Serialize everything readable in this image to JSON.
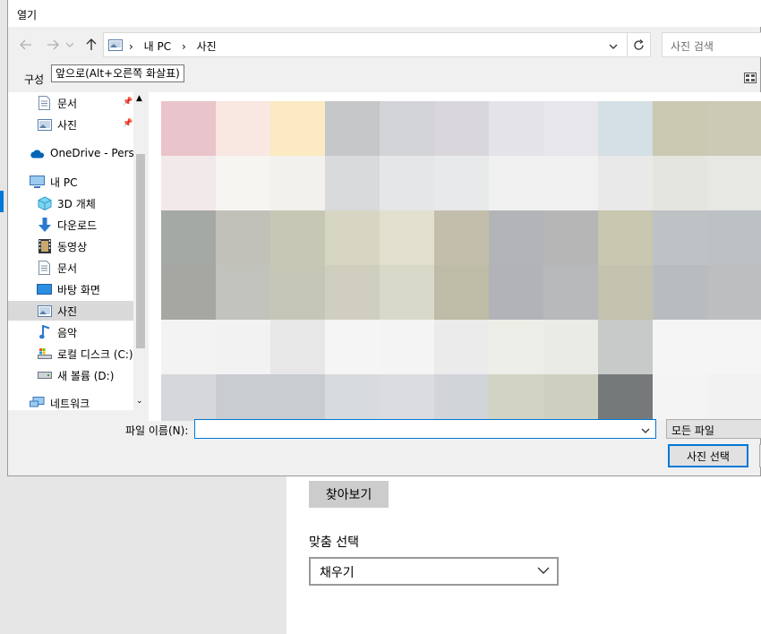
{
  "dialog": {
    "title": "열기",
    "nav": {
      "back_icon": "back-arrow-icon",
      "forward_icon": "forward-arrow-icon",
      "recent_icon": "chevron-down-icon",
      "up_icon": "up-arrow-icon"
    },
    "breadcrumb": [
      "내 PC",
      "사진"
    ],
    "search_placeholder": "사진 검색",
    "toolbar": {
      "organize_label": "구성",
      "tooltip": "앞으로(Alt+오른쪽 화살표)"
    },
    "sidebar": {
      "items": [
        {
          "label": "문서",
          "icon": "document-icon",
          "pinned": true
        },
        {
          "label": "사진",
          "icon": "pictures-icon",
          "pinned": true
        },
        {
          "label": "OneDrive - Person",
          "icon": "onedrive-cloud-icon"
        },
        {
          "label": "내 PC",
          "icon": "computer-icon"
        },
        {
          "label": "3D 개체",
          "icon": "3d-objects-icon"
        },
        {
          "label": "다운로드",
          "icon": "download-arrow-icon"
        },
        {
          "label": "동영상",
          "icon": "video-icon"
        },
        {
          "label": "문서",
          "icon": "document-icon"
        },
        {
          "label": "바탕 화면",
          "icon": "desktop-icon"
        },
        {
          "label": "사진",
          "icon": "pictures-icon",
          "selected": true
        },
        {
          "label": "음악",
          "icon": "music-note-icon"
        },
        {
          "label": "로컬 디스크 (C:)",
          "icon": "local-disk-icon"
        },
        {
          "label": "새 볼륨 (D:)",
          "icon": "drive-icon"
        },
        {
          "label": "네트워크",
          "icon": "network-icon"
        }
      ]
    },
    "filename_label": "파일 이름(N):",
    "filename_value": "",
    "filetype": "모든 파일",
    "open_button": "사진 선택",
    "thumbnail_colors": [
      [
        "#e9c4ca",
        "#f9e7e1",
        "#fbeac2",
        "#c6c7c9",
        "#d2d4d8",
        "#dad7dc",
        "#e4e4e8",
        "#e7e6ea",
        "#d4e0e5",
        "#cac9b2",
        "#cbcbb5"
      ],
      [
        "#f2e9ea",
        "#f7f5f2",
        "#f2f1ed",
        "#d9dadb",
        "#e5e6e8",
        "#e8e9ea",
        "#f0f0f0",
        "#f0f0f0",
        "#e9e9ea",
        "#e5e5df",
        "#e7e7e4"
      ],
      [
        "#a5a9a6",
        "#c1c1ba",
        "#c7c7b5",
        "#d6d6c2",
        "#e1e0cf",
        "#c2beab",
        "#b2b4b7",
        "#b5b6b5",
        "#c8c7af",
        "#bec2c4",
        "#bcc1c3"
      ],
      [
        "#a6a6a2",
        "#c2c3bd",
        "#c6c6b6",
        "#d0cfbf",
        "#d9d9c9",
        "#bdbca7",
        "#b2b3b8",
        "#b8b9bb",
        "#c4c3b0",
        "#b9bcbe",
        "#bcbebf"
      ],
      [
        "#f3f3f3",
        "#f2f2f3",
        "#e7e7e8",
        "#f5f5f5",
        "#f4f4f4",
        "#ebebeb",
        "#eeeee8",
        "#ebebe6",
        "#c7cac9",
        "#f5f5f5",
        "#f5f5f5"
      ],
      [
        "#d5d7da",
        "#c9ccd0",
        "#c9ccd0",
        "#d8dbdd",
        "#dadcdf",
        "#d1d4d8",
        "#d2d3c2",
        "#cfcfbf",
        "#75797a",
        "#f4f4f4",
        "#f2f2f2"
      ]
    ]
  },
  "background": {
    "browse_button": "찾아보기",
    "fit_label": "맞춤 선택",
    "fit_value": "채우기"
  }
}
